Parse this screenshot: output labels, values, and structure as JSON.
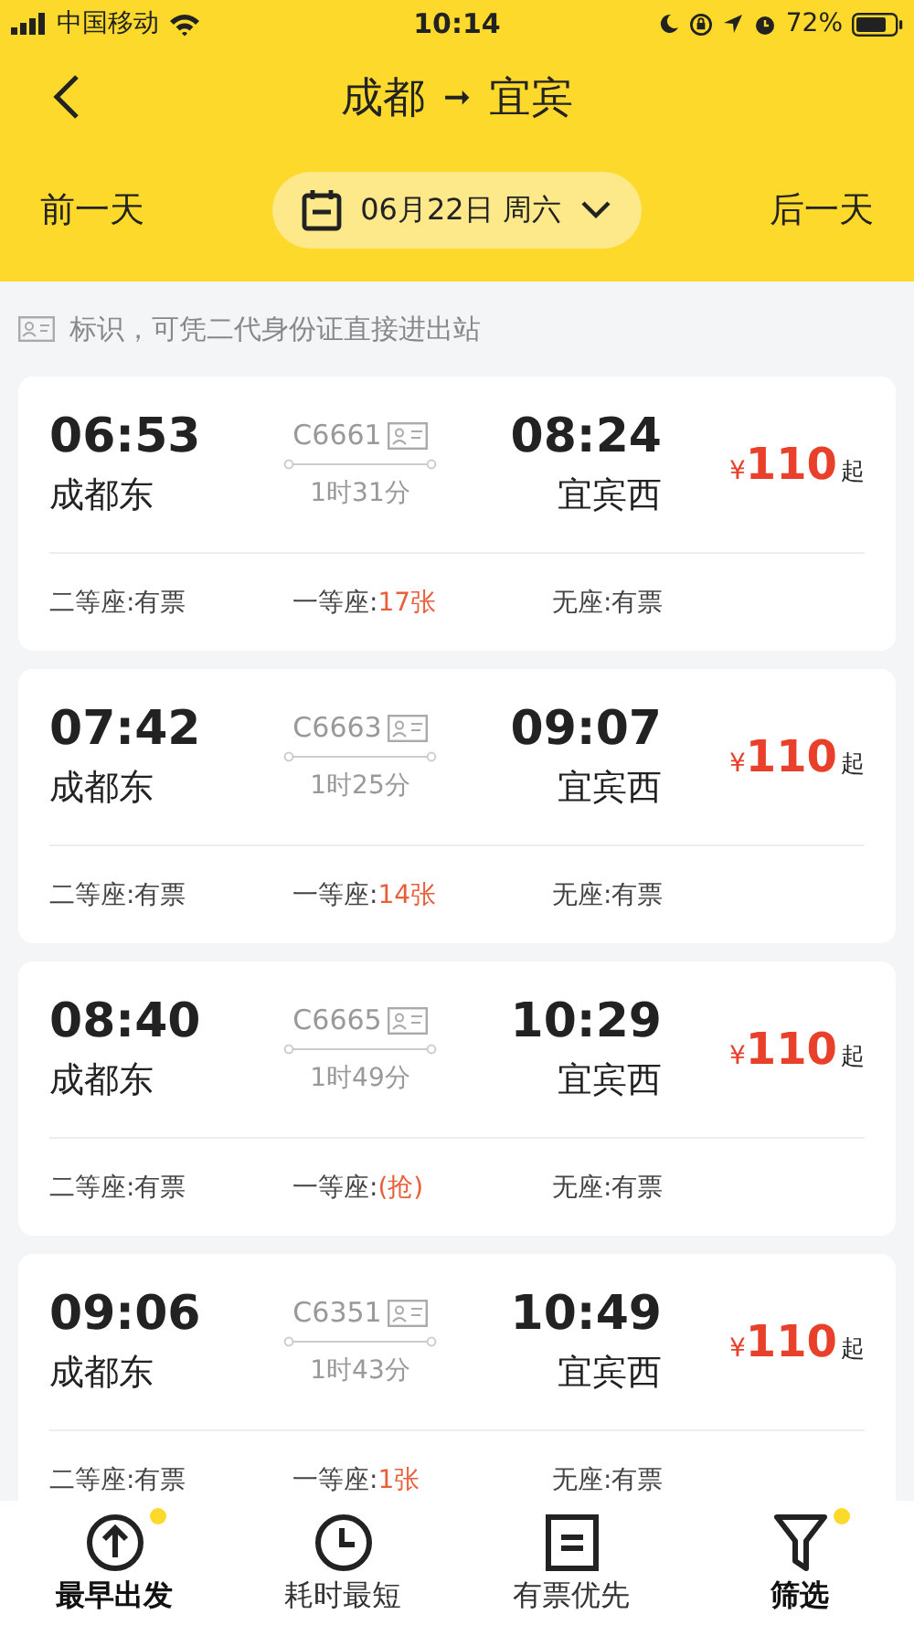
{
  "status_bar": {
    "carrier": "中国移动",
    "time": "10:14",
    "battery": "72%"
  },
  "nav": {
    "title_from": "成都",
    "arrow": "➞",
    "title_to": "宜宾"
  },
  "date_bar": {
    "prev": "前一天",
    "date": "06月22日 周六",
    "next": "后一天"
  },
  "notice": "标识，可凭二代身份证直接进出站",
  "trains": [
    {
      "depart_time": "06:53",
      "depart_station": "成都东",
      "train_no": "C6661",
      "duration": "1时31分",
      "arrive_time": "08:24",
      "arrive_station": "宜宾西",
      "currency": "¥",
      "price": "110",
      "price_suffix": "起",
      "seats": [
        {
          "label": "二等座:",
          "value": "有票",
          "highlight": false
        },
        {
          "label": "一等座:",
          "value": "17张",
          "highlight": true
        },
        {
          "label": "无座:",
          "value": "有票",
          "highlight": false
        }
      ]
    },
    {
      "depart_time": "07:42",
      "depart_station": "成都东",
      "train_no": "C6663",
      "duration": "1时25分",
      "arrive_time": "09:07",
      "arrive_station": "宜宾西",
      "currency": "¥",
      "price": "110",
      "price_suffix": "起",
      "seats": [
        {
          "label": "二等座:",
          "value": "有票",
          "highlight": false
        },
        {
          "label": "一等座:",
          "value": "14张",
          "highlight": true
        },
        {
          "label": "无座:",
          "value": "有票",
          "highlight": false
        }
      ]
    },
    {
      "depart_time": "08:40",
      "depart_station": "成都东",
      "train_no": "C6665",
      "duration": "1时49分",
      "arrive_time": "10:29",
      "arrive_station": "宜宾西",
      "currency": "¥",
      "price": "110",
      "price_suffix": "起",
      "seats": [
        {
          "label": "二等座:",
          "value": "有票",
          "highlight": false
        },
        {
          "label": "一等座:",
          "value": "(抢)",
          "highlight": true
        },
        {
          "label": "无座:",
          "value": "有票",
          "highlight": false
        }
      ]
    },
    {
      "depart_time": "09:06",
      "depart_station": "成都东",
      "train_no": "C6351",
      "duration": "1时43分",
      "arrive_time": "10:49",
      "arrive_station": "宜宾西",
      "currency": "¥",
      "price": "110",
      "price_suffix": "起",
      "seats": [
        {
          "label": "二等座:",
          "value": "有票",
          "highlight": false
        },
        {
          "label": "一等座:",
          "value": "1张",
          "highlight": true
        },
        {
          "label": "无座:",
          "value": "有票",
          "highlight": false
        }
      ]
    }
  ],
  "tab_bar": [
    {
      "kind": "earliest",
      "label": "最早出发",
      "selected": true
    },
    {
      "kind": "shortest",
      "label": "耗时最短",
      "selected": false
    },
    {
      "kind": "available",
      "label": "有票优先",
      "selected": false
    },
    {
      "kind": "filter",
      "label": "筛选",
      "selected": true
    }
  ]
}
